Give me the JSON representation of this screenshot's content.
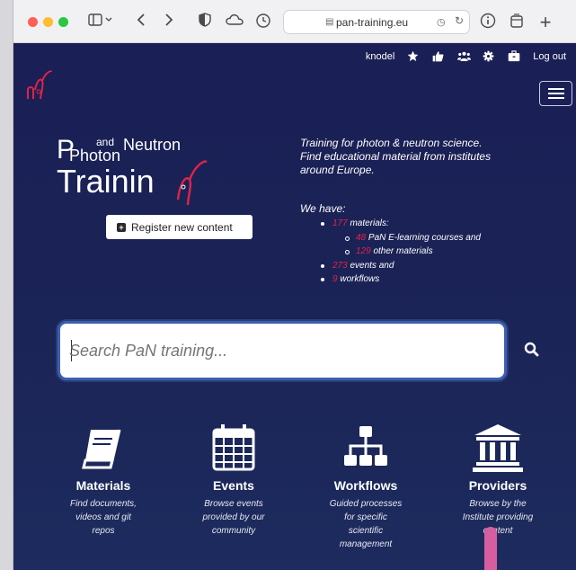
{
  "browser": {
    "url": "pan-training.eu",
    "buttons": [
      "sidebar-toggle",
      "back",
      "forward",
      "privacy",
      "cloud",
      "history",
      "info",
      "share",
      "new-tab"
    ]
  },
  "nav": {
    "user": "knodel",
    "icons": [
      "star-icon",
      "thumbs-up-icon",
      "group-icon",
      "gear-icon",
      "briefcase-icon"
    ],
    "logout": "Log out"
  },
  "brand": {
    "photon": "Photon",
    "and": "and",
    "neutron": "Neutron",
    "training": "Trainin"
  },
  "register": {
    "label": "Register new content"
  },
  "intro": {
    "line1": "Training for photon & neutron science.",
    "line2": "Find educational material from institutes",
    "line3": "around Europe."
  },
  "have": {
    "heading": "We have:",
    "materials_num": "177",
    "materials_txt": " materials:",
    "elearning_num": "48",
    "elearning_txt": " PaN E-learning courses and",
    "other_num": "129",
    "other_txt": " other materials",
    "events_num": "273",
    "events_txt": " events and",
    "workflows_num": "9",
    "workflows_txt": " workflows"
  },
  "search": {
    "placeholder": "Search PaN training..."
  },
  "categories": [
    {
      "title": "Materials",
      "desc": [
        "Find documents,",
        "videos and git",
        "repos"
      ]
    },
    {
      "title": "Events",
      "desc": [
        "Browse events",
        "provided by our",
        "community"
      ]
    },
    {
      "title": "Workflows",
      "desc": [
        "Guided processes",
        "for specific",
        "scientific",
        "management"
      ]
    },
    {
      "title": "Providers",
      "desc": [
        "Browse by the",
        "Institute providing",
        "content"
      ]
    }
  ],
  "colors": {
    "accent": "#e0234a",
    "background": "#1b2456"
  }
}
